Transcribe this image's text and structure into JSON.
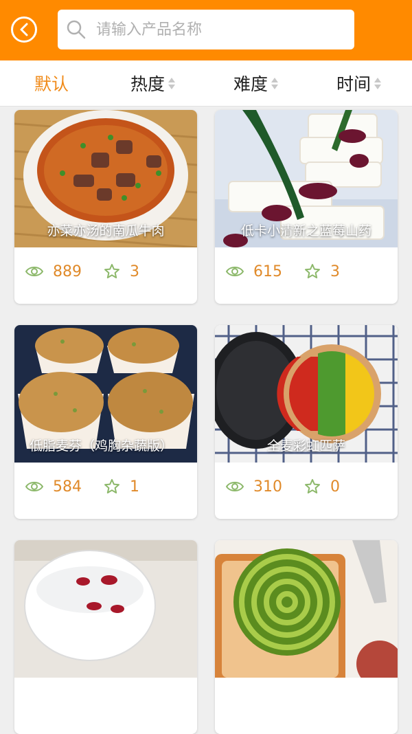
{
  "header": {
    "search_placeholder": "请输入产品名称"
  },
  "sort": {
    "items": [
      {
        "label": "默认",
        "active": true
      },
      {
        "label": "热度",
        "active": false
      },
      {
        "label": "难度",
        "active": false
      },
      {
        "label": "时间",
        "active": false
      }
    ]
  },
  "colors": {
    "accent": "#ff8a00",
    "stat_text": "#e08a2a"
  },
  "cards": [
    {
      "title": "亦菜亦汤的南瓜牛肉",
      "views": "889",
      "stars": "3"
    },
    {
      "title": "低卡小清新之蓝莓山药",
      "views": "615",
      "stars": "3"
    },
    {
      "title": "低脂麦芬（鸡胸杂蔬版）",
      "views": "584",
      "stars": "1"
    },
    {
      "title": "全麦彩虹匹萨",
      "views": "310",
      "stars": "0"
    },
    {
      "title": "",
      "views": "",
      "stars": ""
    },
    {
      "title": "",
      "views": "",
      "stars": ""
    }
  ]
}
